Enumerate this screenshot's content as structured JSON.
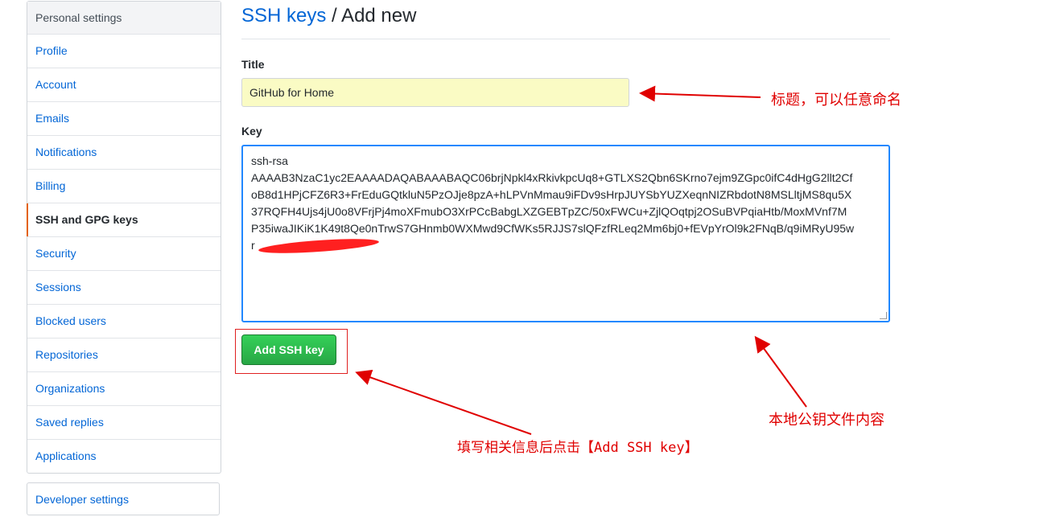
{
  "sidebar": {
    "header": "Personal settings",
    "items": [
      {
        "label": "Profile"
      },
      {
        "label": "Account"
      },
      {
        "label": "Emails"
      },
      {
        "label": "Notifications"
      },
      {
        "label": "Billing"
      },
      {
        "label": "SSH and GPG keys"
      },
      {
        "label": "Security"
      },
      {
        "label": "Sessions"
      },
      {
        "label": "Blocked users"
      },
      {
        "label": "Repositories"
      },
      {
        "label": "Organizations"
      },
      {
        "label": "Saved replies"
      },
      {
        "label": "Applications"
      }
    ],
    "selected": "SSH and GPG keys"
  },
  "developer_settings": "Developer settings",
  "page": {
    "breadcrumb_link": "SSH keys",
    "title_suffix": " / Add new"
  },
  "form": {
    "title_label": "Title",
    "title_value": "GitHub for Home",
    "key_label": "Key",
    "key_lines": [
      "ssh-rsa",
      "AAAAB3NzaC1yc2EAAAADAQABAAABAQC06brjNpkl4xRkivkpcUq8+GTLXS2Qbn6SKrno7ejm9ZGpc0ifC4dHgG2llt2Cf",
      "oB8d1HPjCFZ6R3+FrEduGQtkluN5PzOJje8pzA+hLPVnMmau9iFDv9sHrpJUYSbYUZXeqnNIZRbdotN8MSLltjMS8qu5X",
      "37RQFH4Ujs4jU0o8VFrjPj4moXFmubO3XrPCcBabgLXZGEBTpZC/50xFWCu+ZjlQOqtpj2OSuBVPqiaHtb/MoxMVnf7M",
      "P35iwaJIKiK1K49t8Qe0nTrwS7GHnmb0WXMwd9CfWKs5RJJS7slQFzfRLeq2Mm6bj0+fEVpYrOl9k2FNqB/q9iMRyU95w",
      "r"
    ],
    "submit_label": "Add SSH key"
  },
  "annotations": {
    "title_note": "标题，可以任意命名",
    "key_note": "本地公钥文件内容",
    "button_note": "填写相关信息后点击【Add SSH key】"
  },
  "colors": {
    "link": "#0366d6",
    "selected_marker": "#e36209",
    "title_input_bg": "#fafbc4",
    "button_green": "#28a745",
    "annotation_red": "#e00000"
  }
}
